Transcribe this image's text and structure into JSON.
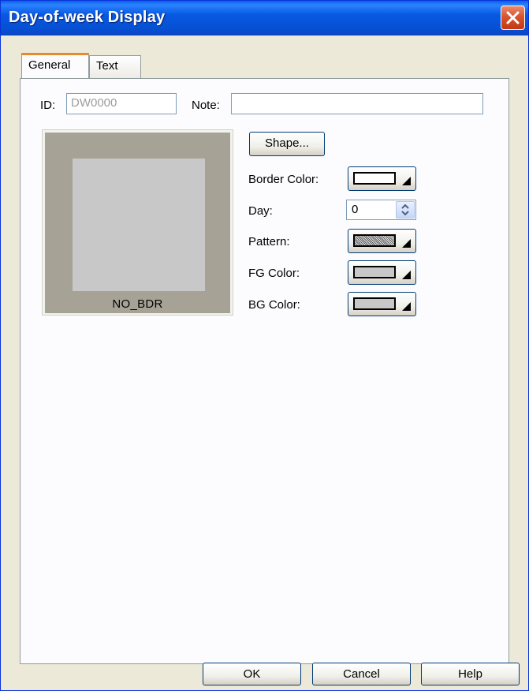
{
  "window": {
    "title": "Day-of-week Display"
  },
  "tabs": [
    {
      "label": "General",
      "active": true
    },
    {
      "label": "Text",
      "active": false
    }
  ],
  "general": {
    "id_label": "ID:",
    "id_value": "DW0000",
    "note_label": "Note:",
    "note_value": "",
    "preview_label": "NO_BDR",
    "shape_button": "Shape...",
    "border_color_label": "Border Color:",
    "day_label": "Day:",
    "day_value": "0",
    "pattern_label": "Pattern:",
    "fg_color_label": "FG Color:",
    "bg_color_label": "BG Color:"
  },
  "swatches": {
    "border_color": "#ffffff",
    "fg_color": "#c8c8c8",
    "bg_color": "#c8c8c8",
    "preview_border": "#a6a396",
    "preview_fill": "#c8c8c8"
  },
  "footer": {
    "ok": "OK",
    "cancel": "Cancel",
    "help": "Help"
  }
}
